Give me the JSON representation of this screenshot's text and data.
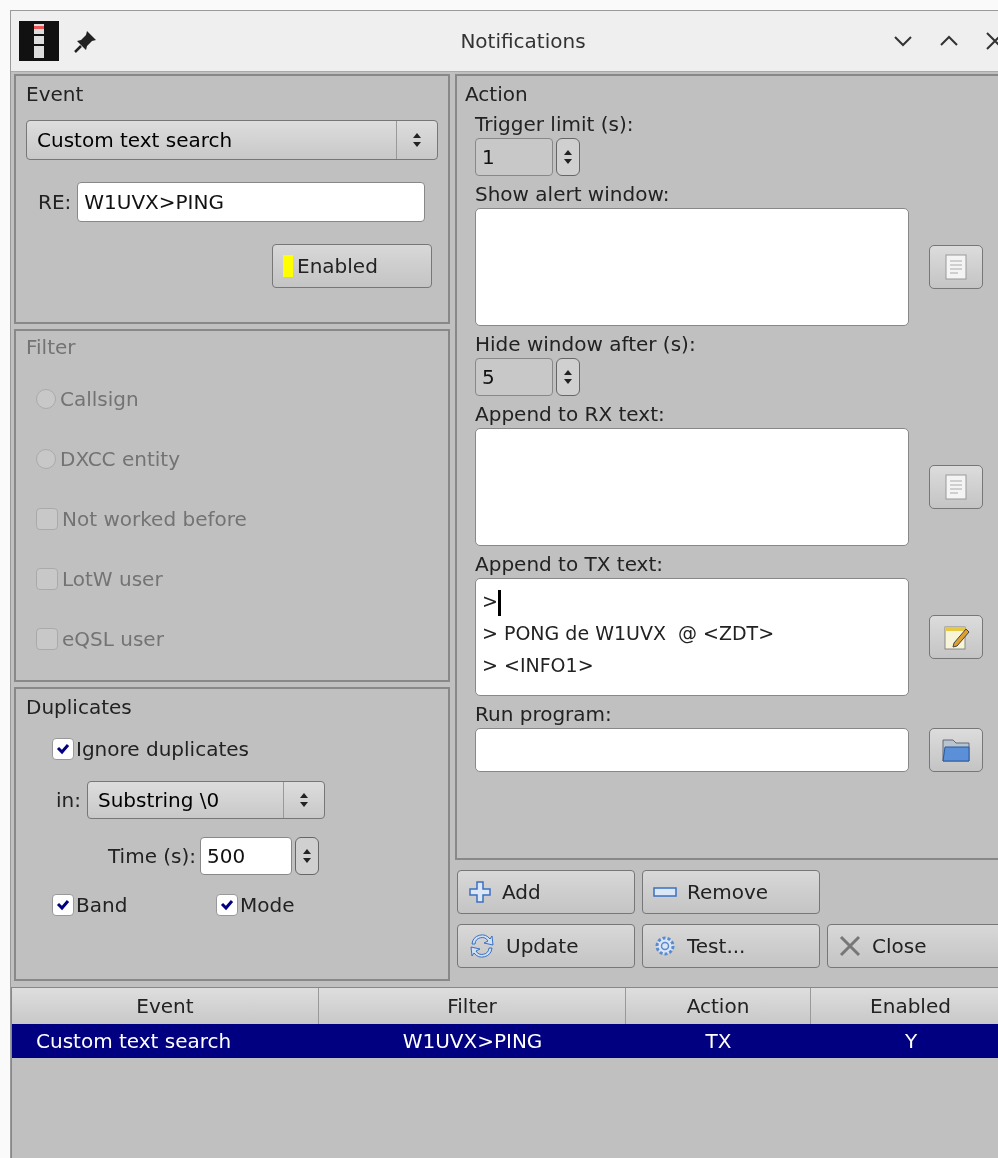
{
  "window": {
    "title": "Notifications"
  },
  "event": {
    "title": "Event",
    "type": "Custom text search",
    "re_label": "RE:",
    "re_value": "W1UVX>PING",
    "enabled_button": {
      "label": "Enabled",
      "on": true
    }
  },
  "filter": {
    "title": "Filter",
    "disabled": true,
    "options": [
      {
        "kind": "radio",
        "label": "Callsign",
        "checked": false
      },
      {
        "kind": "radio",
        "label": "DXCC entity",
        "checked": false
      },
      {
        "kind": "checkbox",
        "label": "Not worked before",
        "checked": false
      },
      {
        "kind": "checkbox",
        "label": "LotW user",
        "checked": false
      },
      {
        "kind": "checkbox",
        "label": "eQSL user",
        "checked": false
      }
    ]
  },
  "duplicates": {
    "title": "Duplicates",
    "ignore": {
      "label": "Ignore duplicates",
      "checked": true
    },
    "in_label": "in:",
    "in_value": "Substring \\0",
    "time_label": "Time (s):",
    "time_value": "500",
    "band": {
      "label": "Band",
      "checked": true
    },
    "mode": {
      "label": "Mode",
      "checked": true
    }
  },
  "action": {
    "title": "Action",
    "fields": [
      {
        "kind": "spin",
        "label": "Trigger limit (s):",
        "value": "1"
      },
      {
        "kind": "message",
        "label": "Show alert window:"
      },
      {
        "kind": "spin",
        "label": "Hide window after (s):",
        "value": "5"
      },
      {
        "kind": "message",
        "label": "Append to RX text:"
      },
      {
        "kind": "macro",
        "label": "Append to TX text:",
        "lines": [
          ">",
          "> PONG de W1UVX  @ <ZDT>",
          "> <INFO1>"
        ]
      },
      {
        "kind": "program",
        "label": "Run program:"
      }
    ]
  },
  "buttons": [
    {
      "label": "Add"
    },
    {
      "label": "Remove"
    },
    {
      "label": "Update"
    },
    {
      "label": "Test..."
    },
    {
      "label": "Close"
    }
  ],
  "table": {
    "columns": [
      "Event",
      "Filter",
      "Action",
      "Enabled"
    ],
    "rows": [
      {
        "cells": [
          "Custom text search",
          "W1UVX>PING",
          "TX",
          "Y"
        ],
        "selected": true
      }
    ]
  }
}
